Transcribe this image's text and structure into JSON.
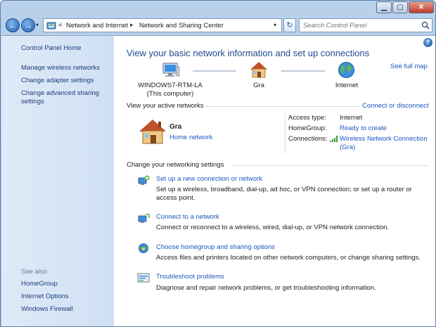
{
  "window": {
    "controls": {
      "minimize": "▁",
      "maximize": "▢",
      "close": "✕"
    }
  },
  "nav": {
    "back_glyph": "←",
    "forward_glyph": "→",
    "history_glyph": "▾",
    "crumb_chevron": "«",
    "breadcrumbs": [
      "Network and Internet",
      "Network and Sharing Center"
    ],
    "crumb_separator": "▸",
    "address_drop_glyph": "▾",
    "refresh_glyph": "↻",
    "search_placeholder": "Search Control Panel"
  },
  "sidebar": {
    "home": "Control Panel Home",
    "items": [
      "Manage wireless networks",
      "Change adapter settings",
      "Change advanced sharing settings"
    ],
    "see_also_label": "See also",
    "see_also": [
      "HomeGroup",
      "Internet Options",
      "Windows Firewall"
    ]
  },
  "main": {
    "help_glyph": "?",
    "title": "View your basic network information and set up connections",
    "see_full_map": "See full map",
    "map": {
      "computer_name": "WINDOWS7-RTM-LA",
      "computer_sub": "(This computer)",
      "network": "Gra",
      "internet": "Internet"
    },
    "active_networks": {
      "heading": "View your active networks",
      "connect_link": "Connect or disconnect",
      "network_name": "Gra",
      "network_type": "Home network",
      "details": {
        "access_type_label": "Access type:",
        "access_type_value": "Internet",
        "homegroup_label": "HomeGroup:",
        "homegroup_value": "Ready to create",
        "connections_label": "Connections:",
        "connections_value": "Wireless Network Connection (Gra)"
      }
    },
    "change_settings": {
      "heading": "Change your networking settings",
      "tasks": [
        {
          "link": "Set up a new connection or network",
          "desc": "Set up a wireless, broadband, dial-up, ad hoc, or VPN connection; or set up a router or access point."
        },
        {
          "link": "Connect to a network",
          "desc": "Connect or reconnect to a wireless, wired, dial-up, or VPN network connection."
        },
        {
          "link": "Choose homegroup and sharing options",
          "desc": "Access files and printers located on other network computers, or change sharing settings."
        },
        {
          "link": "Troubleshoot problems",
          "desc": "Diagnose and repair network problems, or get troubleshooting information."
        }
      ]
    }
  },
  "colors": {
    "link": "#1c56c0",
    "title": "#1e4b8e",
    "sidebar_bg": "#d6e4f5"
  },
  "icons": {
    "computer": "computer-icon",
    "house": "house-icon",
    "globe": "globe-icon",
    "signal": "wifi-signal-icon",
    "search": "search-icon",
    "help": "help-icon"
  }
}
